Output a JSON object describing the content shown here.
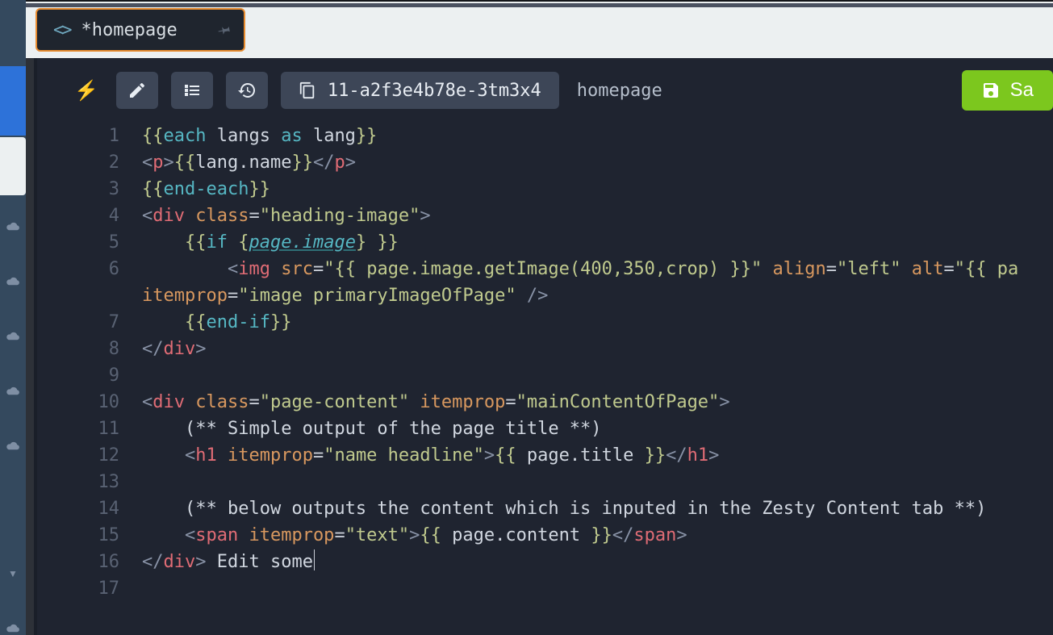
{
  "tab": {
    "title": "*homepage"
  },
  "toolbar": {
    "item_id": "11-a2f3e4b78e-3tm3x4",
    "breadcrumb": "homepage",
    "save_label": "Sa"
  },
  "editor": {
    "lines": [
      {
        "n": 1,
        "segs": [
          [
            "brace",
            "{{"
          ],
          [
            "key",
            "each"
          ],
          [
            "ident",
            " langs "
          ],
          [
            "key",
            "as"
          ],
          [
            "ident",
            " lang"
          ],
          [
            "brace",
            "}}"
          ]
        ]
      },
      {
        "n": 2,
        "segs": [
          [
            "punc",
            "<"
          ],
          [
            "tag",
            "p"
          ],
          [
            "punc",
            ">"
          ],
          [
            "brace",
            "{{"
          ],
          [
            "ident",
            "lang.name"
          ],
          [
            "brace",
            "}}"
          ],
          [
            "punc",
            "</"
          ],
          [
            "tag",
            "p"
          ],
          [
            "punc",
            ">"
          ]
        ]
      },
      {
        "n": 3,
        "segs": [
          [
            "brace",
            "{{"
          ],
          [
            "key",
            "end-each"
          ],
          [
            "brace",
            "}}"
          ]
        ]
      },
      {
        "n": 4,
        "segs": [
          [
            "punc",
            "<"
          ],
          [
            "tag",
            "div"
          ],
          [
            "text",
            " "
          ],
          [
            "attr",
            "class"
          ],
          [
            "op",
            "="
          ],
          [
            "str",
            "\"heading-image\""
          ],
          [
            "punc",
            ">"
          ]
        ]
      },
      {
        "n": 5,
        "indent": 1,
        "segs": [
          [
            "brace",
            "{{"
          ],
          [
            "key",
            "if"
          ],
          [
            "text",
            " "
          ],
          [
            "brace",
            "{"
          ],
          [
            "var",
            "page.image"
          ],
          [
            "brace",
            "}"
          ],
          [
            "text",
            " "
          ],
          [
            "brace",
            "}}"
          ]
        ]
      },
      {
        "n": 6,
        "indent": 2,
        "segs": [
          [
            "punc",
            "<"
          ],
          [
            "tag",
            "img"
          ],
          [
            "text",
            " "
          ],
          [
            "attr",
            "src"
          ],
          [
            "op",
            "="
          ],
          [
            "str",
            "\"{{ page.image.getImage(400,350,crop) }}\""
          ],
          [
            "text",
            " "
          ],
          [
            "attr",
            "align"
          ],
          [
            "op",
            "="
          ],
          [
            "str",
            "\"left\""
          ],
          [
            "text",
            " "
          ],
          [
            "attr",
            "alt"
          ],
          [
            "op",
            "="
          ],
          [
            "str",
            "\"{{ pa"
          ]
        ]
      },
      {
        "n": 0,
        "cont": true,
        "segs": [
          [
            "attr",
            "itemprop"
          ],
          [
            "op",
            "="
          ],
          [
            "str",
            "\"image primaryImageOfPage\""
          ],
          [
            "text",
            " "
          ],
          [
            "punc",
            "/>"
          ]
        ]
      },
      {
        "n": 7,
        "indent": 1,
        "segs": [
          [
            "brace",
            "{{"
          ],
          [
            "key",
            "end-if"
          ],
          [
            "brace",
            "}}"
          ]
        ]
      },
      {
        "n": 8,
        "segs": [
          [
            "punc",
            "</"
          ],
          [
            "tag",
            "div"
          ],
          [
            "punc",
            ">"
          ]
        ]
      },
      {
        "n": 9,
        "segs": []
      },
      {
        "n": 10,
        "segs": [
          [
            "punc",
            "<"
          ],
          [
            "tag",
            "div"
          ],
          [
            "text",
            " "
          ],
          [
            "attr",
            "class"
          ],
          [
            "op",
            "="
          ],
          [
            "str",
            "\"page-content\""
          ],
          [
            "text",
            " "
          ],
          [
            "attr",
            "itemprop"
          ],
          [
            "op",
            "="
          ],
          [
            "str",
            "\"mainContentOfPage\""
          ],
          [
            "punc",
            ">"
          ]
        ]
      },
      {
        "n": 11,
        "indent": 1,
        "segs": [
          [
            "text",
            "(** Simple output of the page title **)"
          ]
        ]
      },
      {
        "n": 12,
        "indent": 1,
        "segs": [
          [
            "punc",
            "<"
          ],
          [
            "tag",
            "h1"
          ],
          [
            "text",
            " "
          ],
          [
            "attr",
            "itemprop"
          ],
          [
            "op",
            "="
          ],
          [
            "str",
            "\"name headline\""
          ],
          [
            "punc",
            ">"
          ],
          [
            "brace",
            "{{"
          ],
          [
            "ident",
            " page.title "
          ],
          [
            "brace",
            "}}"
          ],
          [
            "punc",
            "</"
          ],
          [
            "tag",
            "h1"
          ],
          [
            "punc",
            ">"
          ]
        ]
      },
      {
        "n": 13,
        "indent": 1,
        "segs": []
      },
      {
        "n": 14,
        "indent": 1,
        "segs": [
          [
            "text",
            "(** below outputs the content which is inputed in the Zesty Content tab **)"
          ]
        ]
      },
      {
        "n": 15,
        "indent": 1,
        "segs": [
          [
            "punc",
            "<"
          ],
          [
            "tag",
            "span"
          ],
          [
            "text",
            " "
          ],
          [
            "attr",
            "itemprop"
          ],
          [
            "op",
            "="
          ],
          [
            "str",
            "\"text\""
          ],
          [
            "punc",
            ">"
          ],
          [
            "brace",
            "{{"
          ],
          [
            "ident",
            " page.content "
          ],
          [
            "brace",
            "}}"
          ],
          [
            "punc",
            "</"
          ],
          [
            "tag",
            "span"
          ],
          [
            "punc",
            ">"
          ]
        ]
      },
      {
        "n": 16,
        "segs": [
          [
            "punc",
            "</"
          ],
          [
            "tag",
            "div"
          ],
          [
            "punc",
            ">"
          ],
          [
            "text",
            " Edit some"
          ],
          [
            "cursor",
            ""
          ]
        ]
      },
      {
        "n": 17,
        "segs": []
      }
    ]
  }
}
